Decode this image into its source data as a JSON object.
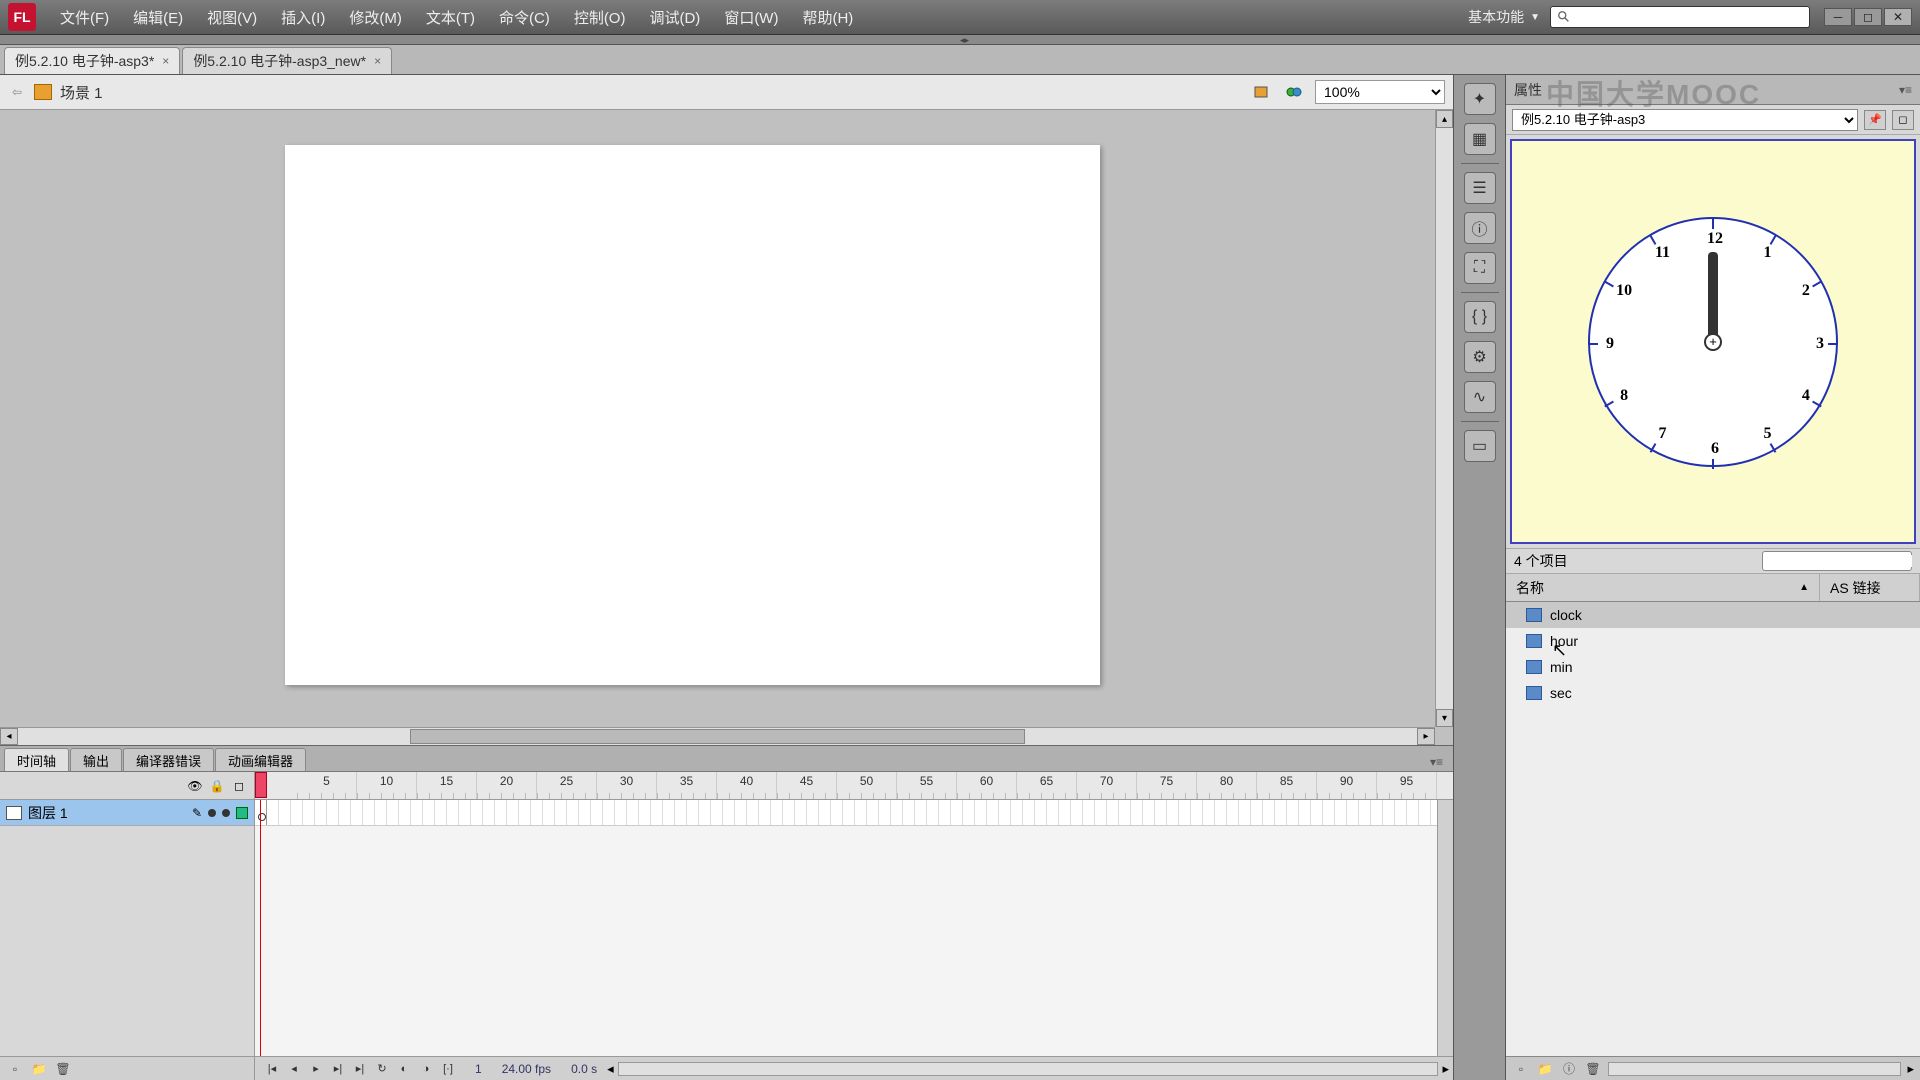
{
  "app": {
    "logo": "FL"
  },
  "menu": {
    "items": [
      "文件(F)",
      "编辑(E)",
      "视图(V)",
      "插入(I)",
      "修改(M)",
      "文本(T)",
      "命令(C)",
      "控制(O)",
      "调试(D)",
      "窗口(W)",
      "帮助(H)"
    ]
  },
  "workspace": {
    "label": "基本功能"
  },
  "doc_tabs": [
    {
      "label": "例5.2.10 电子钟-asp3*",
      "active": true
    },
    {
      "label": "例5.2.10 电子钟-asp3_new*",
      "active": false
    }
  ],
  "scene": {
    "label": "场景 1",
    "zoom": "100%"
  },
  "timeline": {
    "tabs": [
      "时间轴",
      "输出",
      "编译器错误",
      "动画编辑器"
    ],
    "active_tab": 0,
    "ruler_marks": [
      "5",
      "10",
      "15",
      "20",
      "25",
      "30",
      "35",
      "40",
      "45",
      "50",
      "55",
      "60",
      "65",
      "70",
      "75",
      "80",
      "85",
      "90",
      "95"
    ],
    "layer": {
      "name": "图层 1"
    },
    "status": {
      "frame": "1",
      "fps": "24.00 fps",
      "time": "0.0 s"
    }
  },
  "library": {
    "title": "属性",
    "doc_select": "例5.2.10 电子钟-asp3",
    "count": "4 个项目",
    "columns": {
      "name": "名称",
      "linkage": "AS 链接"
    },
    "items": [
      {
        "name": "clock",
        "selected": true
      },
      {
        "name": "hour",
        "selected": false
      },
      {
        "name": "min",
        "selected": false
      },
      {
        "name": "sec",
        "selected": false
      }
    ],
    "clock_numbers": [
      "12",
      "1",
      "2",
      "3",
      "4",
      "5",
      "6",
      "7",
      "8",
      "9",
      "10",
      "11"
    ]
  },
  "watermark": "中国大学MOOC"
}
